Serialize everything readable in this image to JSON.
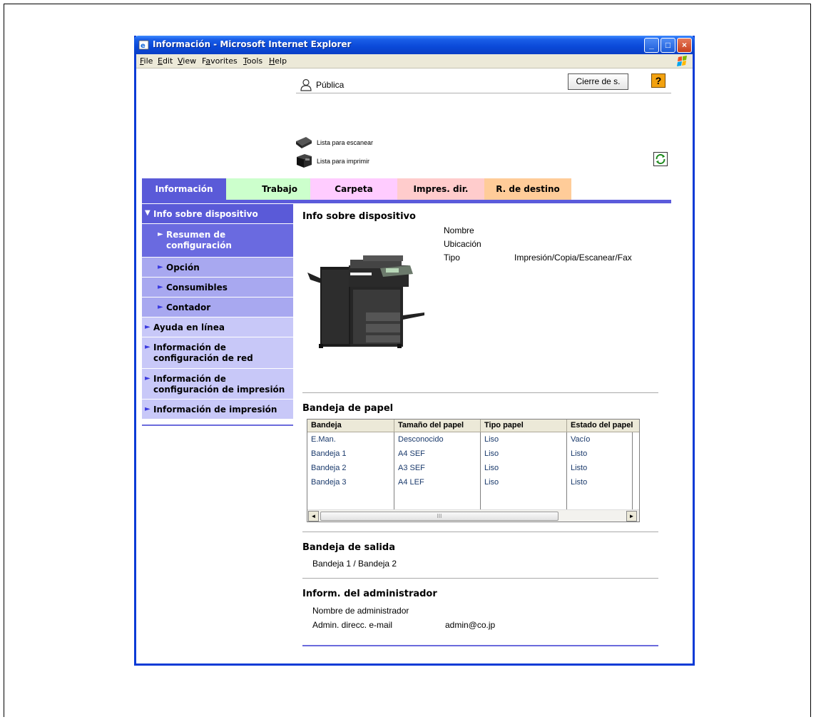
{
  "window": {
    "title": "Información - Microsoft Internet Explorer",
    "controls": {
      "minimize": "_",
      "maximize": "□",
      "close": "×"
    }
  },
  "menubar": {
    "items": [
      {
        "underline": "F",
        "rest": "ile"
      },
      {
        "underline": "E",
        "rest": "dit"
      },
      {
        "underline": "V",
        "rest": "iew"
      },
      {
        "pre": "F",
        "underline": "a",
        "rest": "vorites"
      },
      {
        "underline": "T",
        "rest": "ools"
      },
      {
        "underline": "H",
        "rest": "elp"
      }
    ]
  },
  "header": {
    "user_label": "Pública",
    "logout_label": "Cierre de s.",
    "help_label": "?",
    "scan_status": "Lista para escanear",
    "print_status": "Lista para imprimir"
  },
  "tabs": [
    {
      "label": "Información",
      "bg": "#5a5ad8",
      "color": "#ffffff"
    },
    {
      "label": "Trabajo",
      "bg": "#ccffcc",
      "color": "#000000"
    },
    {
      "label": "Carpeta",
      "bg": "#ffccff",
      "color": "#000000"
    },
    {
      "label": "Impres. dir.",
      "bg": "#ffcccc",
      "color": "#000000"
    },
    {
      "label": "R. de destino",
      "bg": "#ffcc99",
      "color": "#000000"
    }
  ],
  "sidebar": {
    "items": [
      {
        "label": "Info sobre dispositivo",
        "arrow": "▼"
      },
      {
        "label": "Resumen de configuración",
        "arrow": "►"
      },
      {
        "label": "Opción",
        "arrow": "►"
      },
      {
        "label": "Consumibles",
        "arrow": "►"
      },
      {
        "label": "Contador",
        "arrow": "►"
      },
      {
        "label": "Ayuda en línea",
        "arrow": "►"
      },
      {
        "label": "Información de configuración de red",
        "arrow": "►"
      },
      {
        "label": "Información de configuración de impresión",
        "arrow": "►"
      },
      {
        "label": "Información de impresión",
        "arrow": "►"
      }
    ]
  },
  "device_info": {
    "title": "Info sobre dispositivo",
    "fields": [
      {
        "label": "Nombre",
        "value": ""
      },
      {
        "label": "Ubicación",
        "value": ""
      },
      {
        "label": "Tipo",
        "value": "Impresión/Copia/Escanear/Fax"
      }
    ]
  },
  "paper_tray": {
    "title": "Bandeja de papel",
    "columns": [
      "Bandeja",
      "Tamaño del papel",
      "Tipo papel",
      "Estado del papel"
    ],
    "rows": [
      [
        "E.Man.",
        "Desconocido",
        "Liso",
        "Vacío"
      ],
      [
        "Bandeja 1",
        "A4 SEF",
        "Liso",
        "Listo"
      ],
      [
        "Bandeja 2",
        "A3 SEF",
        "Liso",
        "Listo"
      ],
      [
        "Bandeja 3",
        "A4 LEF",
        "Liso",
        "Listo"
      ]
    ],
    "scroll_left": "◄",
    "scroll_right": "►",
    "thumb_grip": "III"
  },
  "output_tray": {
    "title": "Bandeja de salida",
    "value": "Bandeja 1 / Bandeja 2"
  },
  "admin_info": {
    "title": "Inform. del administrador",
    "fields": [
      {
        "label": "Nombre de administrador",
        "value": ""
      },
      {
        "label": "Admin. direcc. e-mail",
        "value": "admin@co.jp"
      }
    ]
  },
  "colors": {
    "accent": "#5b5bdb",
    "sidebar_selected": "#5a5ad8",
    "sidebar_sub": "#a8a8f0",
    "sidebar_item": "#c8c8f8"
  }
}
